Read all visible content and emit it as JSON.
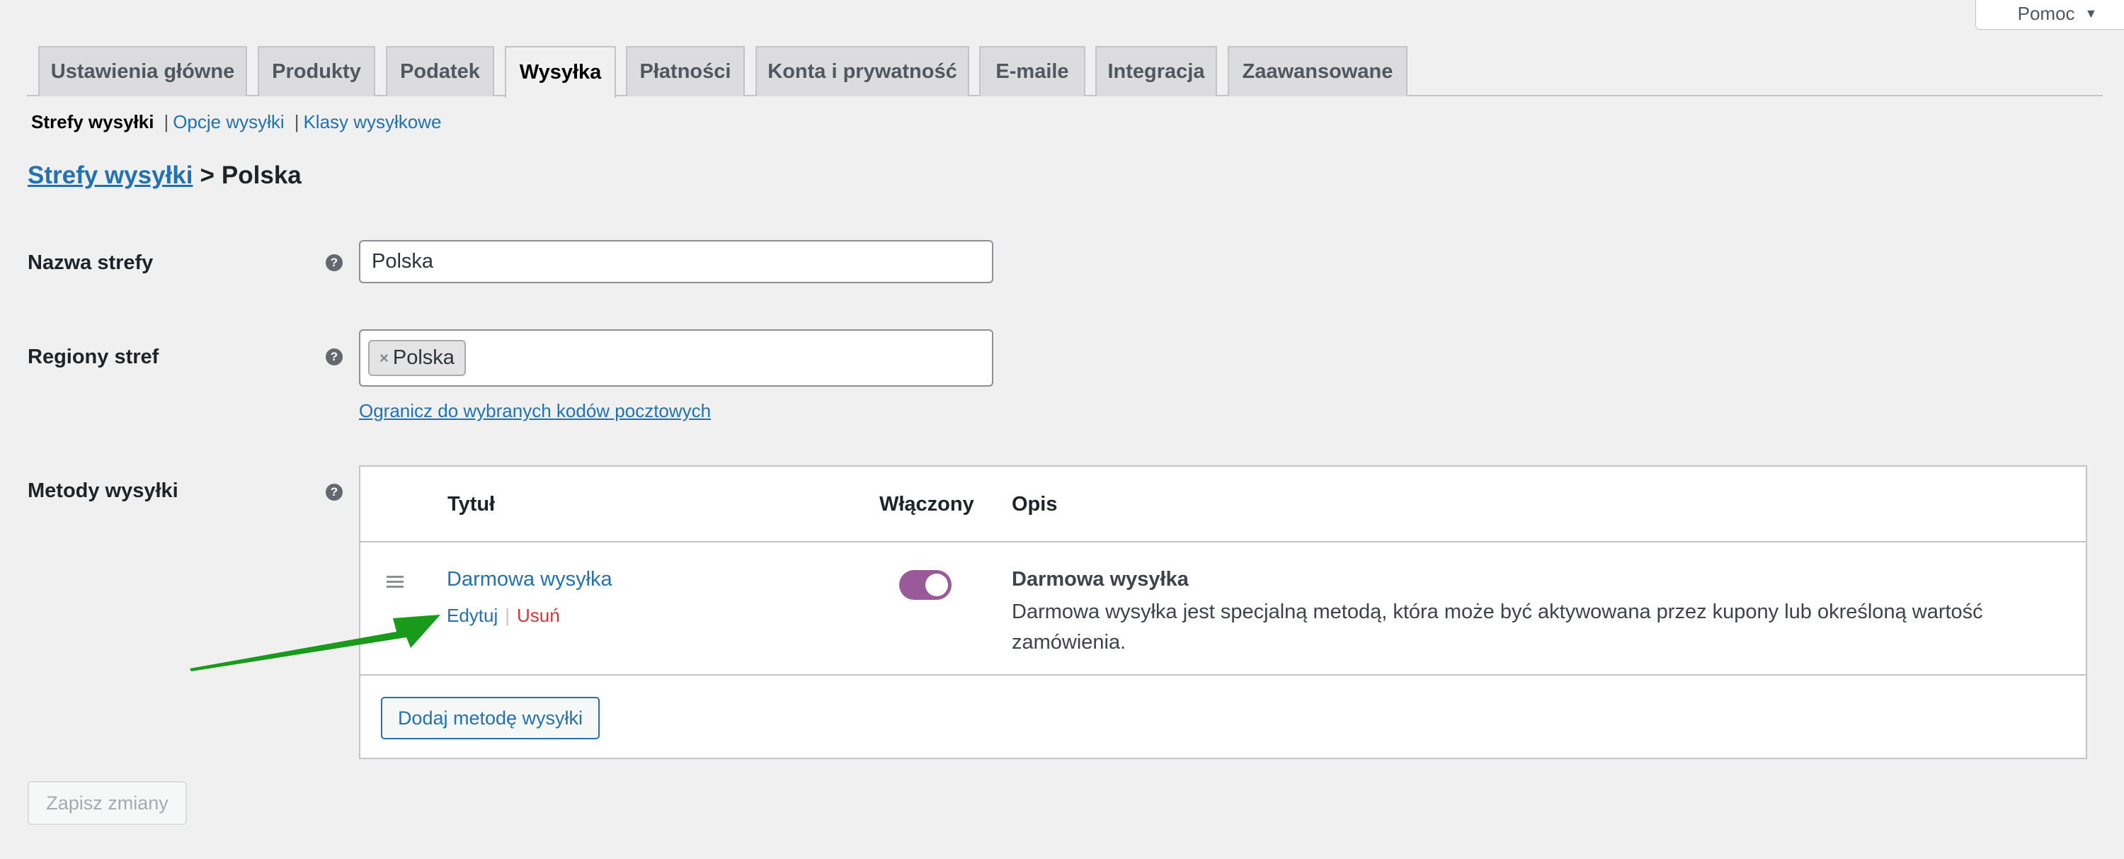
{
  "help": {
    "label": "Pomoc"
  },
  "tabs": [
    {
      "label": "Ustawienia główne"
    },
    {
      "label": "Produkty"
    },
    {
      "label": "Podatek"
    },
    {
      "label": "Wysyłka",
      "active": true
    },
    {
      "label": "Płatności"
    },
    {
      "label": "Konta i prywatność"
    },
    {
      "label": "E-maile"
    },
    {
      "label": "Integracja"
    },
    {
      "label": "Zaawansowane"
    }
  ],
  "subnav": {
    "current": "Strefy wysyłki",
    "separator": "|",
    "links": [
      "Opcje wysyłki",
      "Klasy wysyłkowe"
    ]
  },
  "heading": {
    "link": "Strefy wysyłki",
    "separator": ">",
    "zone": "Polska"
  },
  "form": {
    "zone_name": {
      "label": "Nazwa strefy",
      "value": "Polska"
    },
    "zone_regions": {
      "label": "Regiony stref",
      "chips": [
        "Polska"
      ],
      "postcode_link": "Ogranicz do wybranych kodów pocztowych"
    },
    "methods": {
      "label": "Metody wysyłki"
    }
  },
  "methods_table": {
    "headers": {
      "title": "Tytuł",
      "enabled": "Włączony",
      "description": "Opis"
    },
    "rows": [
      {
        "title": "Darmowa wysyłka",
        "edit": "Edytuj",
        "delete": "Usuń",
        "enabled": true,
        "desc_title": "Darmowa wysyłka",
        "desc_text": "Darmowa wysyłka jest specjalną metodą, która może być aktywowana przez kupony lub określoną wartość zamówienia."
      }
    ],
    "add_button": "Dodaj metodę wysyłki"
  },
  "save_button": "Zapisz zmiany",
  "help_tip_glyph": "?",
  "chip_remove_glyph": "×",
  "colors": {
    "link": "#2271b1",
    "toggle_on": "#9a5a9a",
    "delete": "#d63638",
    "annotation_arrow": "#1a9a1a"
  }
}
